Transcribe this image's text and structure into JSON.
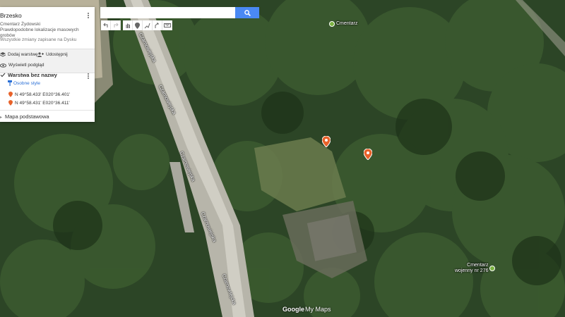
{
  "panel": {
    "title": "Brzesko",
    "subtitle_line1": "Cmentarz Żydowski",
    "subtitle_line2": "Prawdopodobne lokalizacje masowych grobów",
    "saved_status": "Wszystkie zmiany zapisane na Dysku",
    "add_layer_label": "Dodaj warstwę",
    "share_label": "Udostępnij",
    "preview_label": "Wyświetl podgląd",
    "layer_name": "Warstwa bez nazwy",
    "layer_style": "Osobne style",
    "points": [
      {
        "label": "N 49°58.433' E020°36.401'"
      },
      {
        "label": "N 49°58.431' E020°36.411'"
      }
    ],
    "basemap_label": "Mapa podstawowa"
  },
  "search": {
    "placeholder": "",
    "value": ""
  },
  "map": {
    "poi": [
      {
        "label_line1": "Cmentarz",
        "label_line2": ""
      },
      {
        "label_line1": "Cmentarz",
        "label_line2": "wojenny nr 276"
      }
    ],
    "streets": [
      "Czarnowiejska",
      "Czarnowiejska",
      "Czarnowiejska",
      "Czarnowiejska",
      "Czarnowiejska"
    ],
    "logo_google": "Google",
    "logo_mymaps": "My Maps"
  },
  "colors": {
    "accent": "#4a89f3",
    "marker": "#e8622a",
    "poi": "#7cb342"
  }
}
